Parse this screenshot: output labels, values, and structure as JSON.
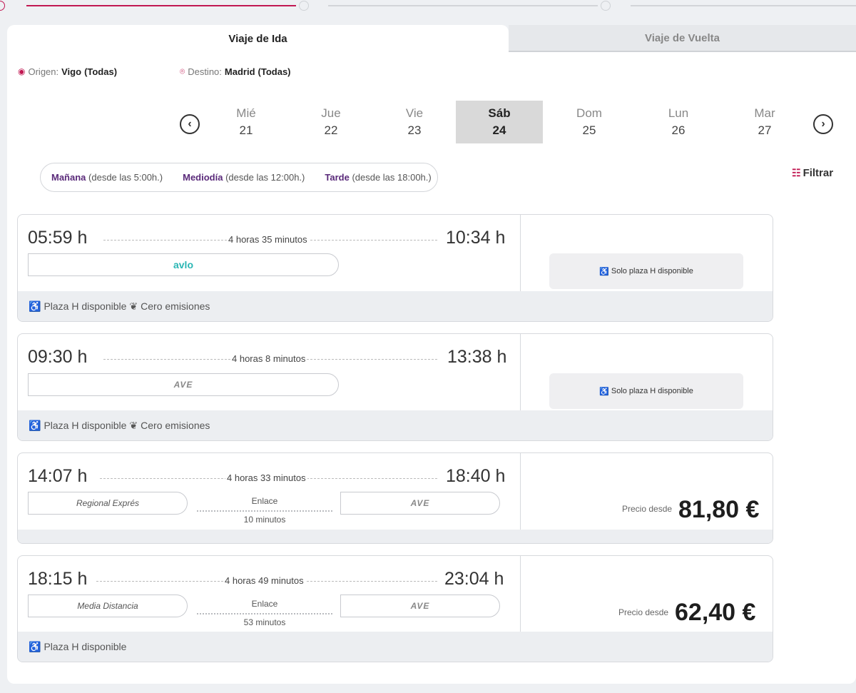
{
  "tabs": {
    "ida": "Viaje de Ida",
    "vuelta": "Viaje de Vuelta"
  },
  "route": {
    "origen_label": "Origen:",
    "origen_city": "Vigo",
    "origen_all": "(Todas)",
    "destino_label": "Destino:",
    "destino_city": "Madrid",
    "destino_all": "(Todas)"
  },
  "dates": [
    {
      "day": "Mié",
      "num": "21"
    },
    {
      "day": "Jue",
      "num": "22"
    },
    {
      "day": "Vie",
      "num": "23"
    },
    {
      "day": "Sáb",
      "num": "24",
      "selected": true
    },
    {
      "day": "Dom",
      "num": "25"
    },
    {
      "day": "Lun",
      "num": "26"
    },
    {
      "day": "Mar",
      "num": "27"
    }
  ],
  "time_filters": [
    {
      "label": "Mañana",
      "detail": "(desde las 5:00h.)"
    },
    {
      "label": "Mediodía",
      "detail": "(desde las 12:00h.)"
    },
    {
      "label": "Tarde",
      "detail": "(desde las 18:00h.)"
    }
  ],
  "filter_button": "Filtrar",
  "trips": [
    {
      "depart": "05:59 h",
      "arrive": "10:34 h",
      "duration": "4 horas 35 minutos",
      "train": "avlo",
      "status": "Solo plaza H disponible",
      "footer": {
        "plaza": "Plaza H disponible",
        "emisiones": "Cero emisiones"
      }
    },
    {
      "depart": "09:30 h",
      "arrive": "13:38 h",
      "duration": "4 horas 8 minutos",
      "train": "AVE",
      "status": "Solo plaza H disponible",
      "footer": {
        "plaza": "Plaza H disponible",
        "emisiones": "Cero emisiones"
      }
    },
    {
      "depart": "14:07 h",
      "arrive": "18:40 h",
      "duration": "4 horas 33 minutos",
      "train1": "Regional Exprés",
      "connection": "Enlace",
      "connection_time": "10 minutos",
      "train2": "AVE",
      "price_label": "Precio desde",
      "price": "81,80 €"
    },
    {
      "depart": "18:15 h",
      "arrive": "23:04 h",
      "duration": "4 horas 49 minutos",
      "train1": "Media Distancia",
      "connection": "Enlace",
      "connection_time": "53 minutos",
      "train2": "AVE",
      "price_label": "Precio desde",
      "price": "62,40 €",
      "footer": {
        "plaza": "Plaza H disponible"
      }
    }
  ]
}
